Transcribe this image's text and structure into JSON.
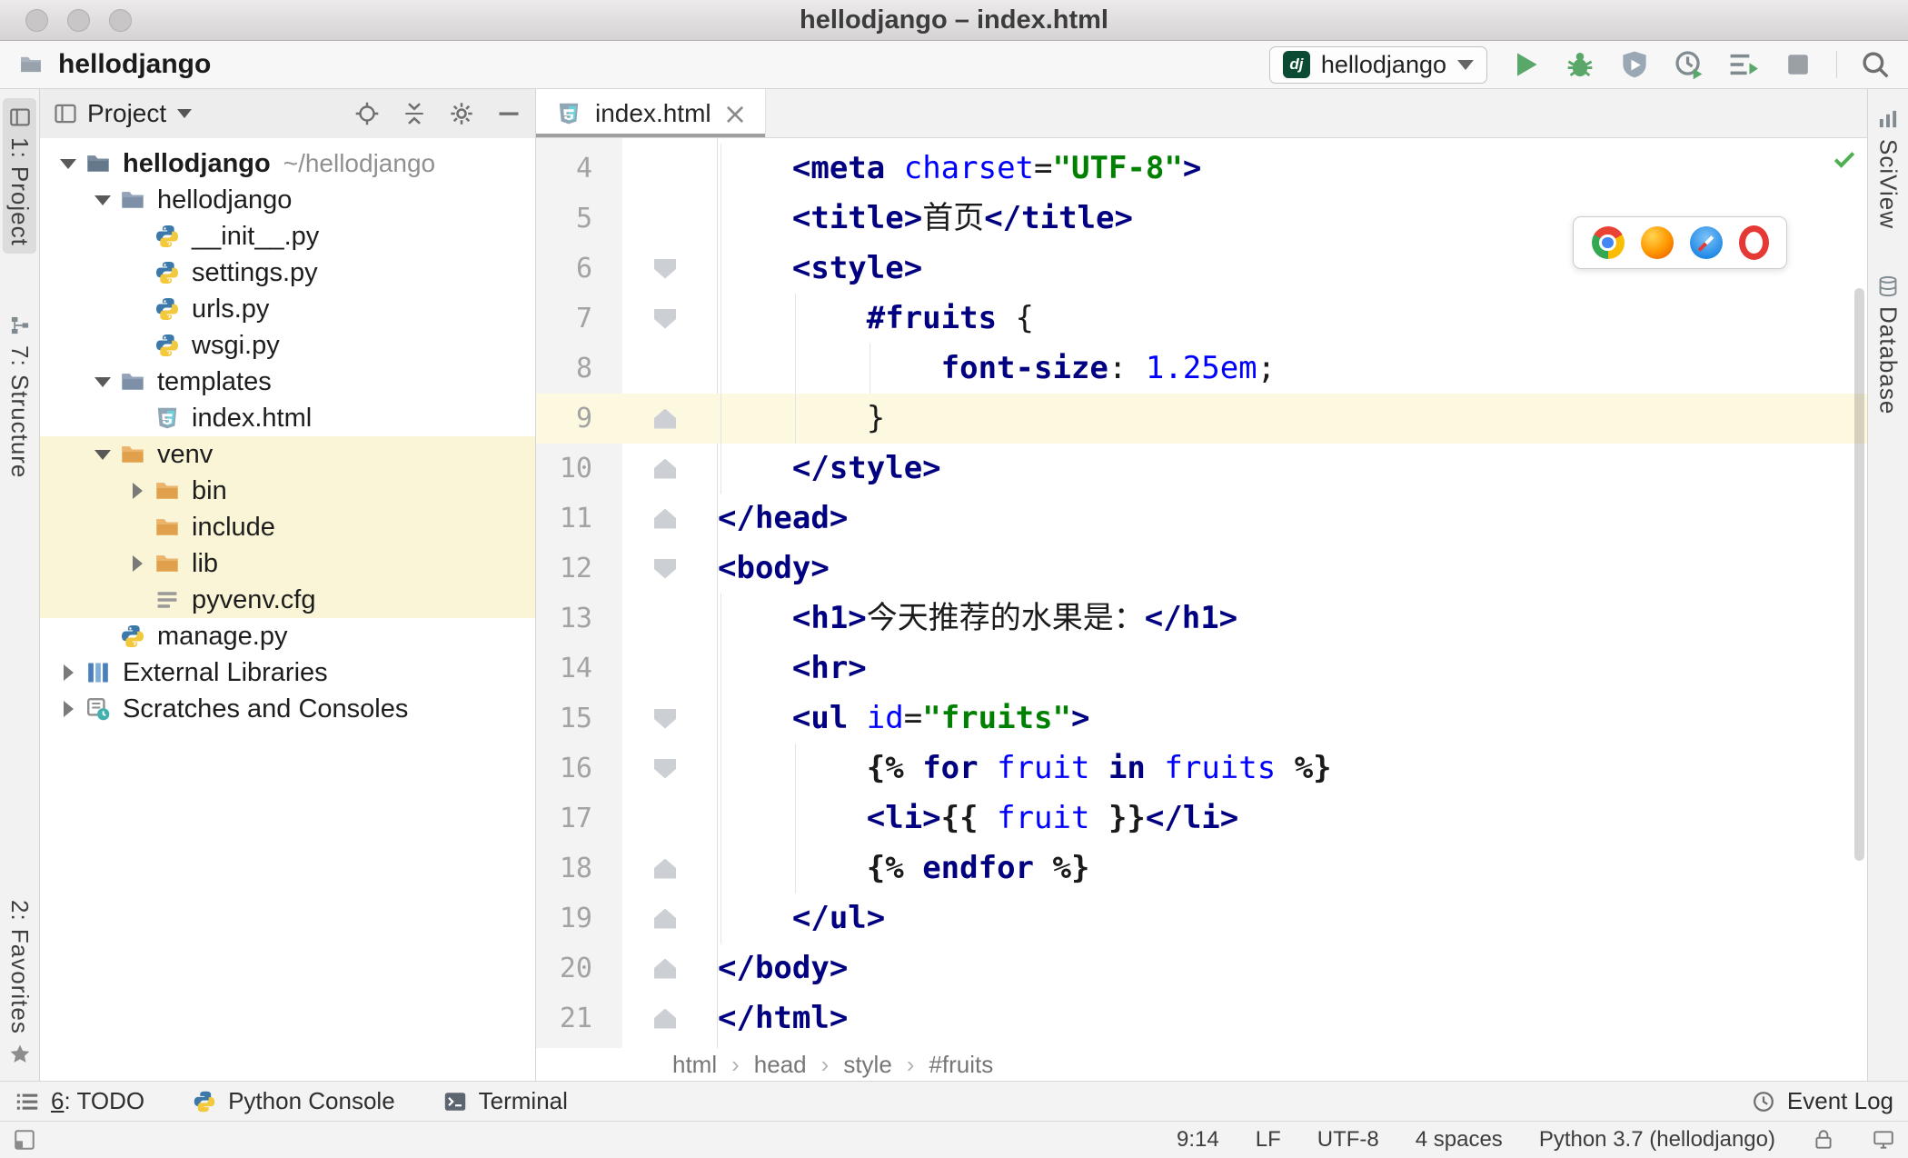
{
  "window": {
    "title": "hellodjango – index.html"
  },
  "toolbar": {
    "project": "hellodjango",
    "run_config": "hellodjango",
    "dj_badge": "dj"
  },
  "strips": {
    "project": "1: Project",
    "structure": "7: Structure",
    "favorites": "2: Favorites",
    "sciview": "SciView",
    "database": "Database"
  },
  "project_panel": {
    "title": "Project",
    "tree": [
      {
        "label": "hellodjango",
        "extra": "~/hellodjango",
        "icon": "folder_root",
        "arrow": "open",
        "level": 0,
        "bold": true
      },
      {
        "label": "hellodjango",
        "icon": "folder",
        "arrow": "open",
        "level": 1
      },
      {
        "label": "__init__.py",
        "icon": "python",
        "arrow": null,
        "level": 2
      },
      {
        "label": "settings.py",
        "icon": "python",
        "arrow": null,
        "level": 2
      },
      {
        "label": "urls.py",
        "icon": "python",
        "arrow": null,
        "level": 2
      },
      {
        "label": "wsgi.py",
        "icon": "python",
        "arrow": null,
        "level": 2
      },
      {
        "label": "templates",
        "icon": "folder",
        "arrow": "open",
        "level": 1
      },
      {
        "label": "index.html",
        "icon": "html",
        "arrow": null,
        "level": 2
      },
      {
        "label": "venv",
        "icon": "folder_ex",
        "arrow": "open",
        "level": 1,
        "highlight": true
      },
      {
        "label": "bin",
        "icon": "folder_ex",
        "arrow": "closed",
        "level": 2,
        "highlight": true
      },
      {
        "label": "include",
        "icon": "folder_ex",
        "arrow": null,
        "level": 2,
        "highlight": true
      },
      {
        "label": "lib",
        "icon": "folder_ex",
        "arrow": "closed",
        "level": 2,
        "highlight": true
      },
      {
        "label": "pyvenv.cfg",
        "icon": "cfg",
        "arrow": null,
        "level": 2,
        "highlight": true
      },
      {
        "label": "manage.py",
        "icon": "python",
        "arrow": null,
        "level": 1
      },
      {
        "label": "External Libraries",
        "icon": "libs",
        "arrow": "closed",
        "level": 0
      },
      {
        "label": "Scratches and Consoles",
        "icon": "scratches",
        "arrow": "closed",
        "level": 0
      }
    ]
  },
  "editor": {
    "tab": "index.html",
    "breadcrumbs": [
      "html",
      "head",
      "style",
      "#fruits"
    ],
    "lines": [
      {
        "n": 4,
        "fold": null,
        "seg": [
          [
            "    ",
            "p"
          ],
          [
            "<meta",
            "t"
          ],
          [
            " ",
            "p"
          ],
          [
            "charset",
            "a"
          ],
          [
            "=",
            "p"
          ],
          [
            "\"UTF-8\"",
            "s"
          ],
          [
            ">",
            "t"
          ]
        ]
      },
      {
        "n": 5,
        "fold": null,
        "seg": [
          [
            "    ",
            "p"
          ],
          [
            "<title>",
            "t"
          ],
          [
            "首页",
            "p"
          ],
          [
            "</title>",
            "t"
          ]
        ]
      },
      {
        "n": 6,
        "fold": "down",
        "seg": [
          [
            "    ",
            "p"
          ],
          [
            "<style>",
            "t"
          ]
        ]
      },
      {
        "n": 7,
        "fold": "down",
        "seg": [
          [
            "        ",
            "p"
          ],
          [
            "#fruits",
            "k"
          ],
          [
            " {",
            "p"
          ]
        ]
      },
      {
        "n": 8,
        "fold": null,
        "seg": [
          [
            "            ",
            "p"
          ],
          [
            "font-size",
            "k"
          ],
          [
            ": ",
            "p"
          ],
          [
            "1.25em",
            "v"
          ],
          [
            ";",
            "p"
          ]
        ]
      },
      {
        "n": 9,
        "fold": "up",
        "current": true,
        "seg": [
          [
            "        }",
            "p"
          ]
        ]
      },
      {
        "n": 10,
        "fold": "up",
        "seg": [
          [
            "    ",
            "p"
          ],
          [
            "</style>",
            "t"
          ]
        ]
      },
      {
        "n": 11,
        "fold": "up",
        "seg": [
          [
            "</head>",
            "t"
          ]
        ]
      },
      {
        "n": 12,
        "fold": "down",
        "seg": [
          [
            "<body>",
            "t"
          ]
        ]
      },
      {
        "n": 13,
        "fold": null,
        "seg": [
          [
            "    ",
            "p"
          ],
          [
            "<h1>",
            "t"
          ],
          [
            "今天推荐的水果是：",
            "p"
          ],
          [
            "</h1>",
            "t"
          ]
        ]
      },
      {
        "n": 14,
        "fold": null,
        "seg": [
          [
            "    ",
            "p"
          ],
          [
            "<hr>",
            "t"
          ]
        ]
      },
      {
        "n": 15,
        "fold": "down",
        "seg": [
          [
            "    ",
            "p"
          ],
          [
            "<ul",
            "t"
          ],
          [
            " ",
            "p"
          ],
          [
            "id",
            "a"
          ],
          [
            "=",
            "p"
          ],
          [
            "\"fruits\"",
            "s"
          ],
          [
            ">",
            "t"
          ]
        ]
      },
      {
        "n": 16,
        "fold": "down",
        "seg": [
          [
            "        ",
            "p"
          ],
          [
            "{%",
            "b"
          ],
          [
            " ",
            "p"
          ],
          [
            "for",
            "k"
          ],
          [
            " ",
            "p"
          ],
          [
            "fruit",
            "v"
          ],
          [
            " ",
            "p"
          ],
          [
            "in",
            "k"
          ],
          [
            " ",
            "p"
          ],
          [
            "fruits",
            "v"
          ],
          [
            " ",
            "p"
          ],
          [
            "%}",
            "b"
          ]
        ]
      },
      {
        "n": 17,
        "fold": null,
        "seg": [
          [
            "        ",
            "p"
          ],
          [
            "<li>",
            "t"
          ],
          [
            "{{",
            "b"
          ],
          [
            " ",
            "p"
          ],
          [
            "fruit",
            "v"
          ],
          [
            " ",
            "p"
          ],
          [
            "}}",
            "b"
          ],
          [
            "</li>",
            "t"
          ]
        ]
      },
      {
        "n": 18,
        "fold": "up",
        "seg": [
          [
            "        ",
            "p"
          ],
          [
            "{%",
            "b"
          ],
          [
            " ",
            "p"
          ],
          [
            "endfor",
            "k"
          ],
          [
            " ",
            "p"
          ],
          [
            "%}",
            "b"
          ]
        ]
      },
      {
        "n": 19,
        "fold": "up",
        "seg": [
          [
            "    ",
            "p"
          ],
          [
            "</ul>",
            "t"
          ]
        ]
      },
      {
        "n": 20,
        "fold": "up",
        "seg": [
          [
            "</body>",
            "t"
          ]
        ]
      },
      {
        "n": 21,
        "fold": "up",
        "seg": [
          [
            "</html>",
            "t"
          ]
        ]
      }
    ]
  },
  "bottom_bar": {
    "todo_mnemonic": "6",
    "todo_label": ": TODO",
    "python_console": "Python Console",
    "terminal": "Terminal",
    "event_log": "Event Log"
  },
  "status_bar": {
    "caret": "9:14",
    "line_ending": "LF",
    "encoding": "UTF-8",
    "indent": "4 spaces",
    "interpreter": "Python 3.7 (hellodjango)"
  },
  "colors": {
    "run_green": "#59A869",
    "keyword_navy": "#000080",
    "value_blue": "#0000ff",
    "string_green": "#008000",
    "excluded_folder_orange": "#E0A04C",
    "highlight_yellow": "#faf5d6",
    "current_line_yellow": "#fdf8e0"
  }
}
